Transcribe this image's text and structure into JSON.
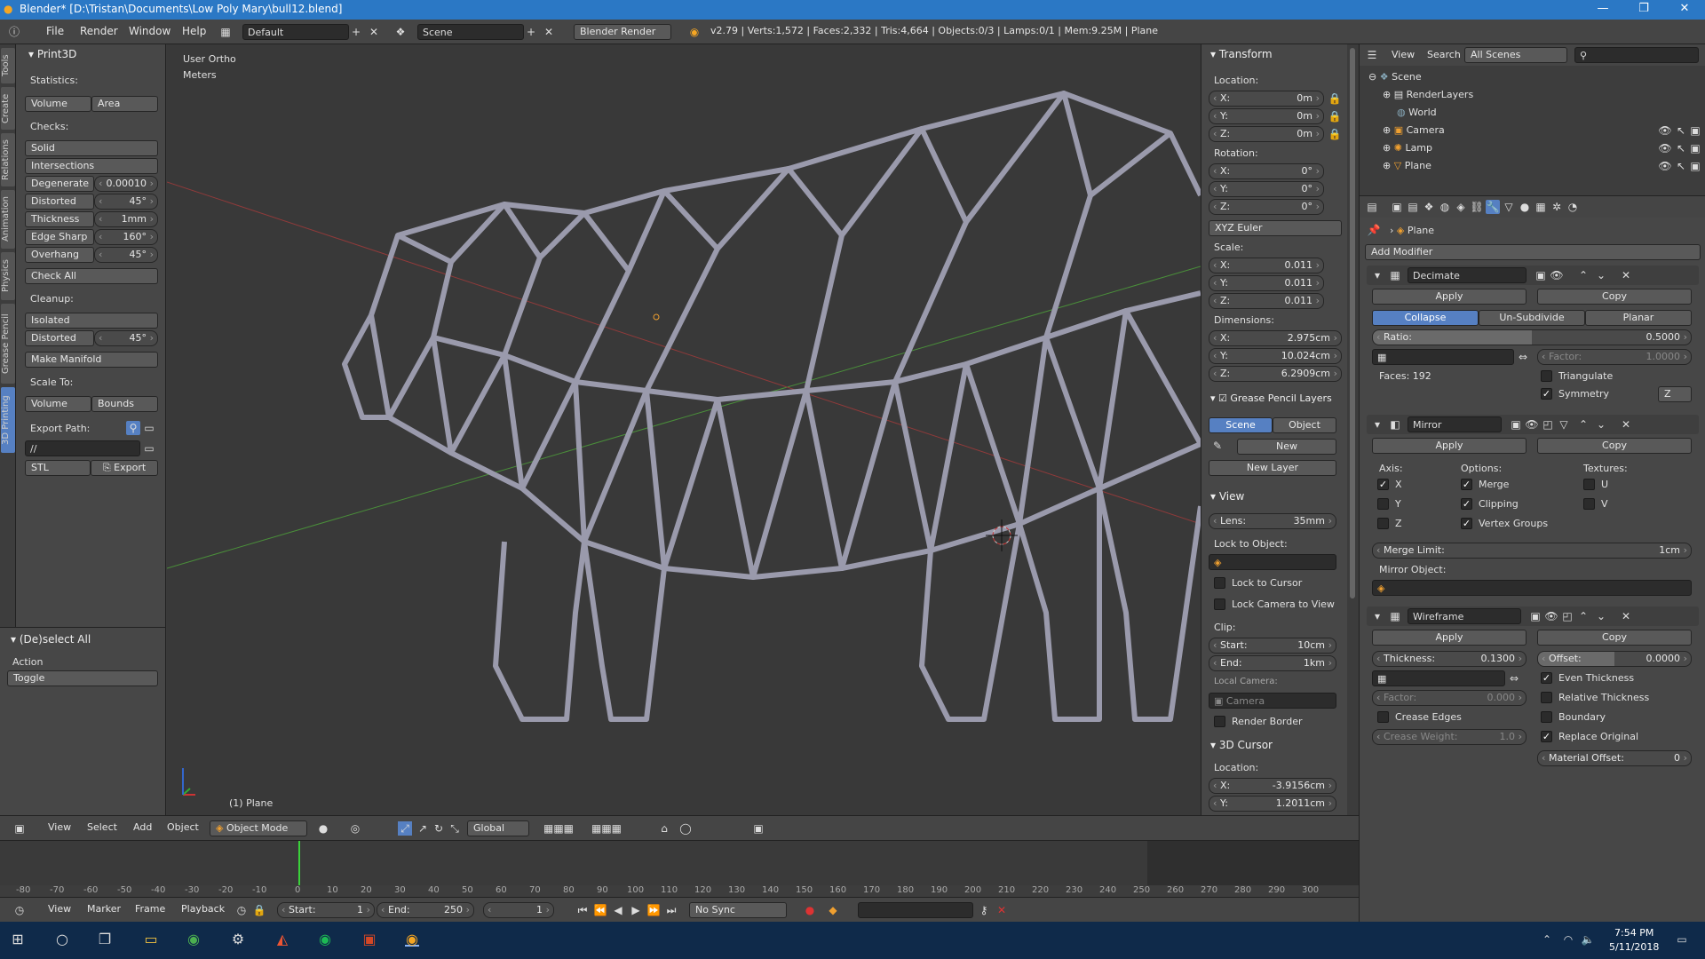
{
  "window": {
    "title": "Blender* [D:\\Tristan\\Documents\\Low Poly Mary\\bull12.blend]"
  },
  "topbar": {
    "menus": [
      "File",
      "Render",
      "Window",
      "Help"
    ],
    "layout": "Default",
    "scene": "Scene",
    "engine": "Blender Render",
    "stats": "v2.79 | Verts:1,572 | Faces:2,332 | Tris:4,664 | Objects:0/3 | Lamps:0/1 | Mem:9.25M | Plane"
  },
  "tabs": [
    "Tools",
    "Create",
    "Relations",
    "Animation",
    "Physics",
    "Grease Pencil",
    "3D Printing"
  ],
  "print3d": {
    "title": "Print3D",
    "statistics": "Statistics:",
    "volume": "Volume",
    "area": "Area",
    "checks": "Checks:",
    "solid": "Solid",
    "intersections": "Intersections",
    "degenerate": "Degenerate",
    "degenerate_val": "0.00010",
    "distorted": "Distorted",
    "distorted_val": "45°",
    "thickness": "Thickness",
    "thickness_val": "1mm",
    "edge_sharp": "Edge Sharp",
    "edge_sharp_val": "160°",
    "overhang": "Overhang",
    "overhang_val": "45°",
    "check_all": "Check All",
    "cleanup": "Cleanup:",
    "isolated": "Isolated",
    "distorted2": "Distorted",
    "distorted2_val": "45°",
    "make_manifold": "Make Manifold",
    "scale_to": "Scale To:",
    "volume2": "Volume",
    "bounds": "Bounds",
    "export_path": "Export Path:",
    "path": "//",
    "format": "STL",
    "export": "Export"
  },
  "deselect": {
    "title": "(De)select All",
    "action": "Action",
    "toggle": "Toggle"
  },
  "viewport": {
    "view_label": "User Ortho",
    "units": "Meters",
    "object": "(1) Plane"
  },
  "transform": {
    "title": "Transform",
    "location": "Location:",
    "loc": [
      {
        "k": "X:",
        "v": "0m"
      },
      {
        "k": "Y:",
        "v": "0m"
      },
      {
        "k": "Z:",
        "v": "0m"
      }
    ],
    "rotation": "Rotation:",
    "rot": [
      {
        "k": "X:",
        "v": "0°"
      },
      {
        "k": "Y:",
        "v": "0°"
      },
      {
        "k": "Z:",
        "v": "0°"
      }
    ],
    "euler": "XYZ Euler",
    "scale": "Scale:",
    "scl": [
      {
        "k": "X:",
        "v": "0.011"
      },
      {
        "k": "Y:",
        "v": "0.011"
      },
      {
        "k": "Z:",
        "v": "0.011"
      }
    ],
    "dimensions": "Dimensions:",
    "dim": [
      {
        "k": "X:",
        "v": "2.975cm"
      },
      {
        "k": "Y:",
        "v": "10.024cm"
      },
      {
        "k": "Z:",
        "v": "6.2909cm"
      }
    ]
  },
  "grease": {
    "title": "Grease Pencil Layers",
    "scene": "Scene",
    "object": "Object",
    "new": "New",
    "new_layer": "New Layer"
  },
  "view": {
    "title": "View",
    "lens_k": "Lens:",
    "lens_v": "35mm",
    "lock_obj": "Lock to Object:",
    "lock_cursor": "Lock to Cursor",
    "lock_cam": "Lock Camera to View",
    "clip": "Clip:",
    "start_k": "Start:",
    "start_v": "10cm",
    "end_k": "End:",
    "end_v": "1km",
    "local_cam": "Local Camera:",
    "camera": "Camera",
    "render_border": "Render Border"
  },
  "cursor3d": {
    "title": "3D Cursor",
    "location": "Location:",
    "x_k": "X:",
    "x_v": "-3.9156cm",
    "y_k": "Y:",
    "y_v": "1.2011cm"
  },
  "outliner": {
    "view": "View",
    "search": "Search",
    "scenes": "All Scenes",
    "items": [
      "Scene",
      "RenderLayers",
      "World",
      "Camera",
      "Lamp",
      "Plane"
    ]
  },
  "props": {
    "object": "Plane",
    "add_modifier": "Add Modifier",
    "decimate": {
      "name": "Decimate",
      "apply": "Apply",
      "copy": "Copy",
      "modes": [
        "Collapse",
        "Un-Subdivide",
        "Planar"
      ],
      "ratio_k": "Ratio:",
      "ratio_v": "0.5000",
      "factor_k": "Factor:",
      "factor_v": "1.0000",
      "faces": "Faces: 192",
      "triangulate": "Triangulate",
      "symmetry": "Symmetry",
      "axis": "Z"
    },
    "mirror": {
      "name": "Mirror",
      "apply": "Apply",
      "copy": "Copy",
      "axis": "Axis:",
      "options": "Options:",
      "textures": "Textures:",
      "x": "X",
      "y": "Y",
      "z": "Z",
      "merge": "Merge",
      "clipping": "Clipping",
      "vgroups": "Vertex Groups",
      "u": "U",
      "v": "V",
      "merge_limit_k": "Merge Limit:",
      "merge_limit_v": "1cm",
      "mirror_obj": "Mirror Object:"
    },
    "wireframe": {
      "name": "Wireframe",
      "apply": "Apply",
      "copy": "Copy",
      "thickness_k": "Thickness:",
      "thickness_v": "0.1300",
      "offset_k": "Offset:",
      "offset_v": "0.0000",
      "factor_k": "Factor:",
      "factor_v": "0.000",
      "even": "Even Thickness",
      "relative": "Relative Thickness",
      "crease_edges": "Crease Edges",
      "boundary": "Boundary",
      "crease_weight_k": "Crease Weight:",
      "crease_weight_v": "1.0",
      "replace": "Replace Original",
      "mat_offset_k": "Material Offset:",
      "mat_offset_v": "0"
    }
  },
  "vpfooter": {
    "menus": [
      "View",
      "Select",
      "Add",
      "Object"
    ],
    "mode": "Object Mode",
    "orient": "Global"
  },
  "timeline": {
    "ticks": [
      "-80",
      "-70",
      "-60",
      "-50",
      "-40",
      "-30",
      "-20",
      "-10",
      "0",
      "10",
      "20",
      "30",
      "40",
      "50",
      "60",
      "70",
      "80",
      "90",
      "100",
      "110",
      "120",
      "130",
      "140",
      "150",
      "160",
      "170",
      "180",
      "190",
      "200",
      "210",
      "220",
      "230",
      "240",
      "250",
      "260",
      "270",
      "280",
      "290",
      "300"
    ],
    "menus": [
      "View",
      "Marker",
      "Frame",
      "Playback"
    ],
    "start_k": "Start:",
    "start_v": "1",
    "end_k": "End:",
    "end_v": "250",
    "current": "1",
    "sync": "No Sync"
  },
  "taskbar": {
    "time": "7:54 PM",
    "date": "5/11/2018"
  }
}
